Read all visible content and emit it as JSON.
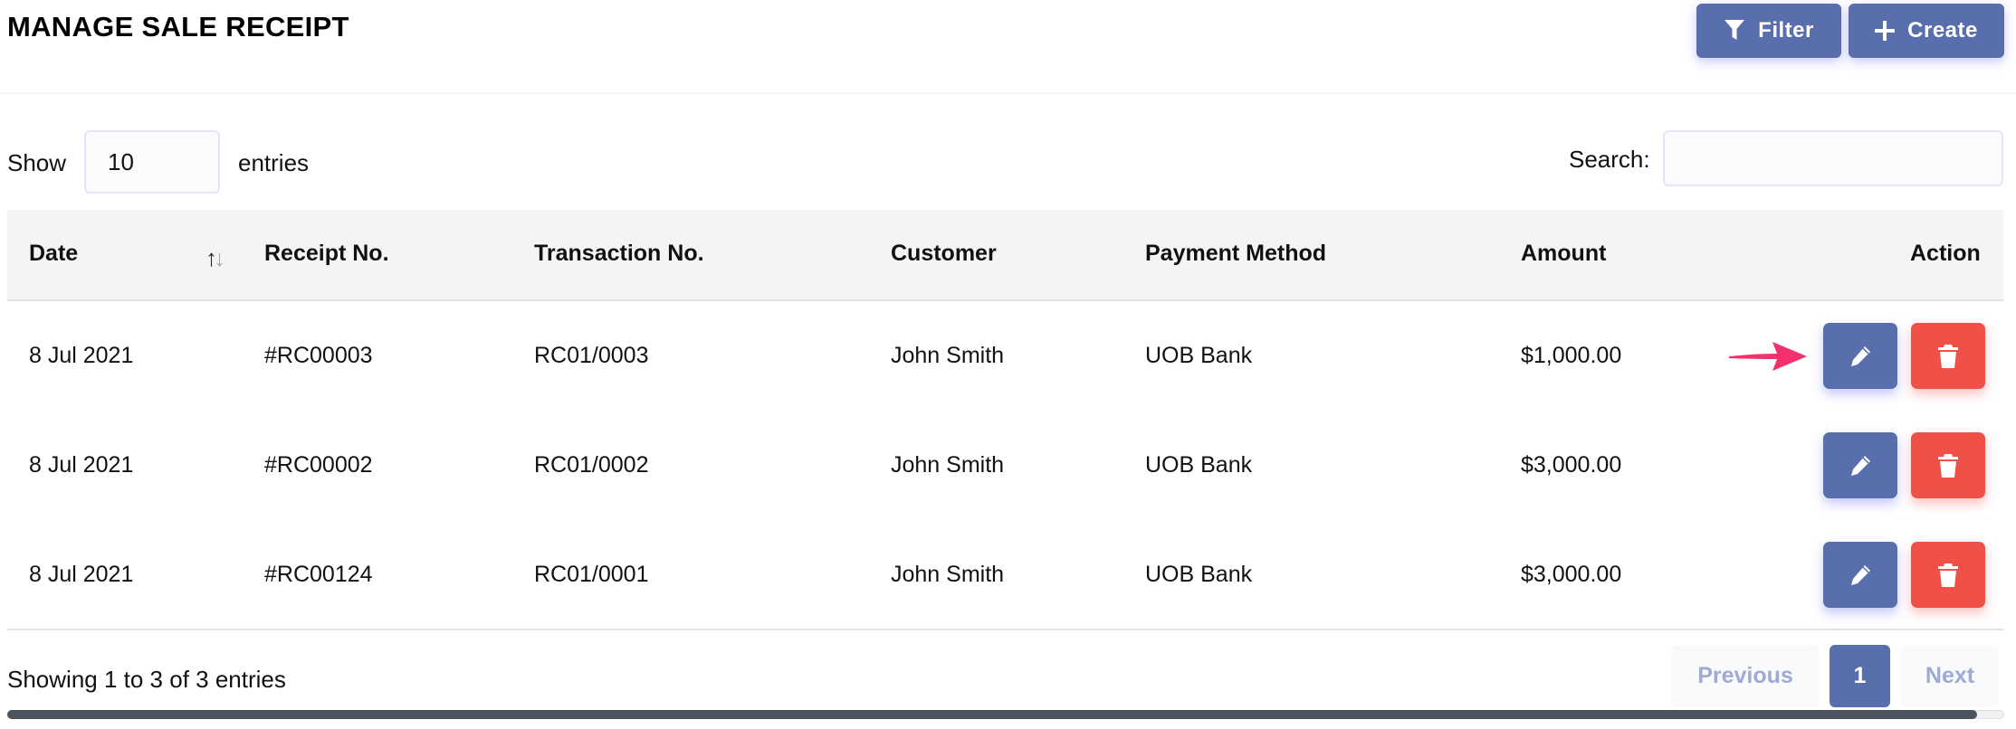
{
  "page": {
    "title": "MANAGE SALE RECEIPT",
    "filter_label": "Filter",
    "create_label": "Create"
  },
  "length": {
    "show_label": "Show",
    "value": "10",
    "entries_label": "entries"
  },
  "search": {
    "label": "Search:",
    "value": "",
    "placeholder": ""
  },
  "table": {
    "columns": [
      "Date",
      "Receipt No.",
      "Transaction No.",
      "Customer",
      "Payment Method",
      "Amount",
      "Action"
    ],
    "sort_icon": "sort-arrows-icon",
    "rows": [
      {
        "date": "8 Jul 2021",
        "receipt_no": "#RC00003",
        "transaction_no": "RC01/0003",
        "customer": "John Smith",
        "payment_method": "UOB Bank",
        "amount": "$1,000.00"
      },
      {
        "date": "8 Jul 2021",
        "receipt_no": "#RC00002",
        "transaction_no": "RC01/0002",
        "customer": "John Smith",
        "payment_method": "UOB Bank",
        "amount": "$3,000.00"
      },
      {
        "date": "8 Jul 2021",
        "receipt_no": "#RC00124",
        "transaction_no": "RC01/0001",
        "customer": "John Smith",
        "payment_method": "UOB Bank",
        "amount": "$3,000.00"
      }
    ]
  },
  "footer": {
    "info": "Showing 1 to 3 of 3 entries",
    "previous_label": "Previous",
    "current_page": "1",
    "next_label": "Next"
  },
  "colors": {
    "primary": "#586ead",
    "danger": "#ef5048",
    "annotation_arrow": "#f5306c"
  }
}
